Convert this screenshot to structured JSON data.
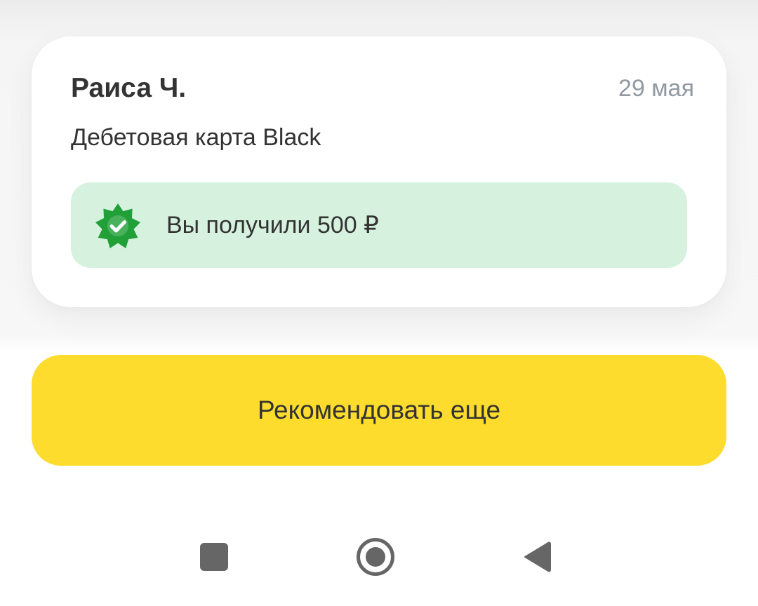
{
  "referral_card": {
    "name": "Раиса Ч.",
    "date": "29 мая",
    "product": "Дебетовая карта Black",
    "reward": {
      "icon": "verified-badge-icon",
      "text": "Вы получили 500 ₽"
    }
  },
  "cta": {
    "label": "Рекомендовать еще"
  },
  "system_nav": {
    "icons": [
      "recents-square-icon",
      "home-circle-icon",
      "back-triangle-icon"
    ]
  },
  "colors": {
    "accent_yellow": "#fddc2d",
    "reward_bg": "#d6f2df",
    "badge_green": "#21a038",
    "muted_text": "#9299a2",
    "primary_text": "#333333",
    "nav_icon": "#666666"
  }
}
